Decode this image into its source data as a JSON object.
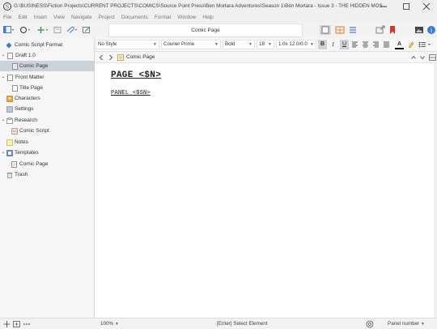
{
  "window": {
    "title": "G:\\BUSINESS\\Fiction Projects\\CURRENT PROJECTS\\COMICS\\Source Point Press\\Ben Mortara Adventures\\Season 1\\Ben Mortara - Issue 3 - THE HIDDEN MOS..."
  },
  "menu": [
    "File",
    "Edit",
    "Insert",
    "View",
    "Navigate",
    "Project",
    "Documents",
    "Format",
    "Window",
    "Help"
  ],
  "toolbar": {
    "document_title": "Comic Page"
  },
  "binder": {
    "items": [
      {
        "label": "Comic Script Format"
      },
      {
        "label": "Draft 1.0"
      },
      {
        "label": "Comic Page"
      },
      {
        "label": "Front Matter"
      },
      {
        "label": "Title Page"
      },
      {
        "label": "Characters"
      },
      {
        "label": "Settings"
      },
      {
        "label": "Research"
      },
      {
        "label": "Comic Script"
      },
      {
        "label": "Notes"
      },
      {
        "label": "Templates"
      },
      {
        "label": "Comic Page"
      },
      {
        "label": "Trash"
      }
    ]
  },
  "format_bar": {
    "style": "No Style",
    "font": "Courier Prime",
    "weight": "Bold",
    "size": "18",
    "spacing": "1.0x 12.0/0.0",
    "bold_label": "B",
    "italic_label": "I",
    "underline_label": "U",
    "text_color_label": "A"
  },
  "header": {
    "doc_name": "Comic Page"
  },
  "editor": {
    "page_heading": "PAGE <$N>",
    "panel_heading": "PANEL <$SN>"
  },
  "status": {
    "zoom": "100%",
    "hint": "[Enter] Select Element",
    "panel_number": "Panel number"
  },
  "colors": {
    "accent_blue": "#3a7bd5",
    "bookmark_red": "#d9352b",
    "selection_gray": "#cdd2d8",
    "layout_orange": "#e8782a"
  }
}
